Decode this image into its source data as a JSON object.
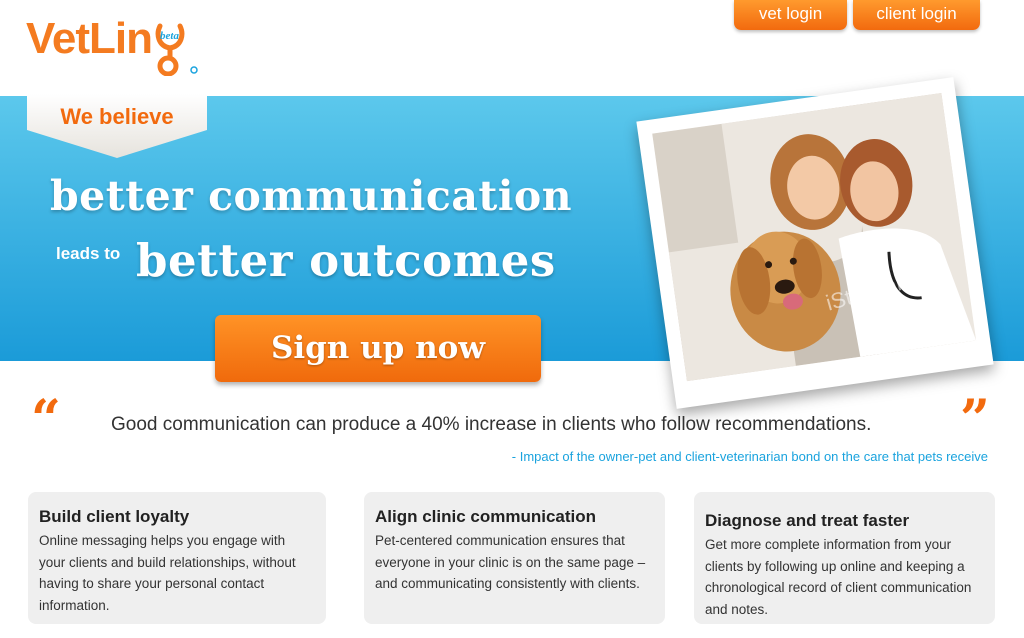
{
  "header": {
    "logo_text": "VetLin",
    "logo_badge": "beta",
    "vet_login_label": "vet login",
    "client_login_label": "client login"
  },
  "hero": {
    "tag": "We believe",
    "headline_line1": "better communication",
    "leads_to": "leads to",
    "headline_line2": "better outcomes",
    "signup_label": "Sign up now",
    "photo_watermark": "iStockphoto"
  },
  "quote": {
    "text": "Good communication can produce a 40% increase in clients who follow recommendations.",
    "source": "- Impact of the owner-pet and client-veterinarian bond on the care that pets receive"
  },
  "features": [
    {
      "title": "Build client loyalty",
      "body": "Online messaging helps you engage with your clients and build relationships, without having to share your personal contact information."
    },
    {
      "title": "Align clinic communication",
      "body": "Pet-centered communication ensures that everyone in your clinic is on the same page – and communicating consistently with clients."
    },
    {
      "title": "Diagnose and treat faster",
      "body": "Get more complete information from your clients by following up online and keeping a chronological record of client communication and notes."
    }
  ],
  "colors": {
    "brand_orange": "#f26a0e",
    "brand_blue": "#1aa3de",
    "hero_top": "#5cc8ec",
    "hero_bottom": "#1b9bd8",
    "card_bg": "#efefef"
  },
  "icons": {
    "quote_open": "“",
    "quote_close": "”",
    "logo_mark": "stethoscope-icon"
  }
}
